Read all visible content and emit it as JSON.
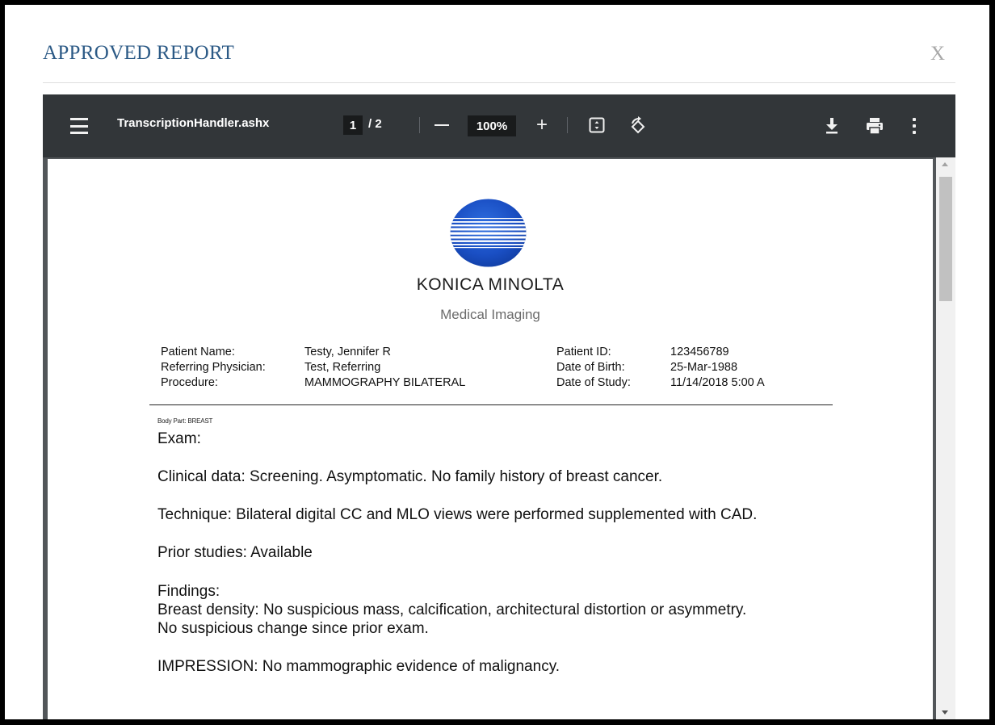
{
  "modal": {
    "title": "APPROVED REPORT",
    "close_label": "X"
  },
  "viewer": {
    "file_name": "TranscriptionHandler.ashx",
    "current_page": "1",
    "page_total": "/ 2",
    "zoom": "100%",
    "zoom_in_label": "+",
    "icons": [
      "menu-icon",
      "zoom-out-icon",
      "zoom-in-icon",
      "fit-to-page-icon",
      "rotate-icon",
      "download-icon",
      "print-icon",
      "more-options-icon"
    ]
  },
  "report": {
    "brand": "KONICA MINOLTA",
    "tagline": "Medical Imaging",
    "labels": {
      "patient_name": "Patient Name:",
      "referring_physician": "Referring Physician:",
      "procedure": "Procedure:",
      "patient_id": "Patient ID:",
      "date_of_birth": "Date of Birth:",
      "date_of_study": "Date of Study:"
    },
    "values": {
      "patient_name": "Testy, Jennifer R",
      "referring_physician": "Test, Referring",
      "procedure": "MAMMOGRAPHY BILATERAL",
      "patient_id": "123456789",
      "date_of_birth": "25-Mar-1988",
      "date_of_study": "11/14/2018 5:00 A"
    },
    "body_part": "Body Part: BREAST",
    "exam": "Exam:",
    "clinical_data": "Clinical data: Screening. Asymptomatic. No family history of breast cancer.",
    "technique": "Technique: Bilateral digital CC and MLO views were performed supplemented with CAD.",
    "prior_studies": "Prior studies: Available",
    "findings_heading": "Findings:",
    "findings_line1": "Breast density: No suspicious mass, calcification, architectural distortion or asymmetry.",
    "findings_line2": "No suspicious change since prior exam.",
    "impression": "IMPRESSION: No mammographic evidence of malignancy."
  },
  "colors": {
    "title_blue": "#2c5a86",
    "toolbar_bg": "#323639",
    "viewer_bg": "#525659",
    "logo_blue": "#1a4fc4"
  }
}
